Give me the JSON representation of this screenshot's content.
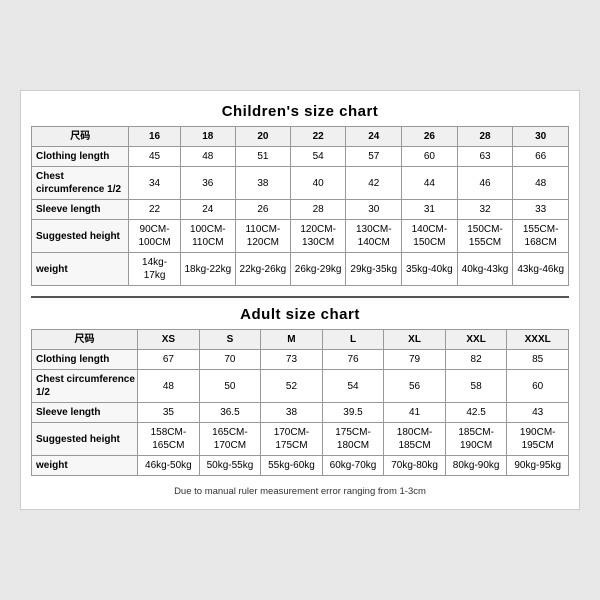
{
  "children_chart": {
    "title": "Children's size chart",
    "columns": [
      "尺码",
      "16",
      "18",
      "20",
      "22",
      "24",
      "26",
      "28",
      "30"
    ],
    "rows": [
      {
        "label": "Clothing length",
        "values": [
          "45",
          "48",
          "51",
          "54",
          "57",
          "60",
          "63",
          "66"
        ]
      },
      {
        "label": "Chest circumference 1/2",
        "values": [
          "34",
          "36",
          "38",
          "40",
          "42",
          "44",
          "46",
          "48"
        ]
      },
      {
        "label": "Sleeve length",
        "values": [
          "22",
          "24",
          "26",
          "28",
          "30",
          "31",
          "32",
          "33"
        ]
      },
      {
        "label": "Suggested height",
        "values": [
          "90CM-100CM",
          "100CM-110CM",
          "110CM-120CM",
          "120CM-130CM",
          "130CM-140CM",
          "140CM-150CM",
          "150CM-155CM",
          "155CM-168CM"
        ]
      },
      {
        "label": "weight",
        "values": [
          "14kg-17kg",
          "18kg-22kg",
          "22kg-26kg",
          "26kg-29kg",
          "29kg-35kg",
          "35kg-40kg",
          "40kg-43kg",
          "43kg-46kg"
        ]
      }
    ]
  },
  "adult_chart": {
    "title": "Adult size chart",
    "columns": [
      "尺码",
      "XS",
      "S",
      "M",
      "L",
      "XL",
      "XXL",
      "XXXL"
    ],
    "rows": [
      {
        "label": "Clothing length",
        "values": [
          "67",
          "70",
          "73",
          "76",
          "79",
          "82",
          "85"
        ]
      },
      {
        "label": "Chest circumference 1/2",
        "values": [
          "48",
          "50",
          "52",
          "54",
          "56",
          "58",
          "60"
        ]
      },
      {
        "label": "Sleeve length",
        "values": [
          "35",
          "36.5",
          "38",
          "39.5",
          "41",
          "42.5",
          "43"
        ]
      },
      {
        "label": "Suggested height",
        "values": [
          "158CM-165CM",
          "165CM-170CM",
          "170CM-175CM",
          "175CM-180CM",
          "180CM-185CM",
          "185CM-190CM",
          "190CM-195CM"
        ]
      },
      {
        "label": "weight",
        "values": [
          "46kg-50kg",
          "50kg-55kg",
          "55kg-60kg",
          "60kg-70kg",
          "70kg-80kg",
          "80kg-90kg",
          "90kg-95kg"
        ]
      }
    ]
  },
  "note": "Due to manual ruler measurement error ranging from 1-3cm"
}
